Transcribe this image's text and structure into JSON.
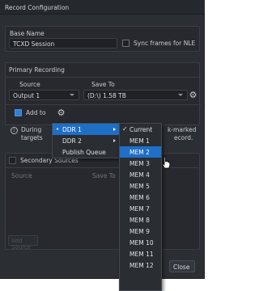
{
  "window": {
    "title": "Record Configuration"
  },
  "base_name": {
    "label": "Base Name",
    "value": "TCXD Session",
    "sync_label": "Sync frames for NLE"
  },
  "primary": {
    "section_label": "Primary Recording",
    "source_header": "Source",
    "saveto_header": "Save To",
    "source_value": "Output 1",
    "saveto_value": "(D:\\) 1.58 TB",
    "addto_label": "Add to",
    "info_line1_start": "During",
    "info_line1_end": "k-marked",
    "info_line2_start": "targets",
    "info_line2_end": "ecord."
  },
  "secondary": {
    "section_label": "Secondary Sources",
    "source_header": "Source",
    "saveto_header": "Save To",
    "add_button": "Add Source"
  },
  "footer": {
    "close_label": "Close"
  },
  "menu1": {
    "items": [
      {
        "label": "DDR 1",
        "bullet": "•"
      },
      {
        "label": "DDR 2"
      },
      {
        "label": "Publish Queue"
      }
    ]
  },
  "menu2": {
    "check": "✓",
    "items": [
      "Current",
      "MEM 1",
      "MEM 2",
      "MEM 3",
      "MEM 4",
      "MEM 5",
      "MEM 6",
      "MEM 7",
      "MEM 8",
      "MEM 9",
      "MEM 10",
      "MEM 11",
      "MEM 12"
    ]
  }
}
